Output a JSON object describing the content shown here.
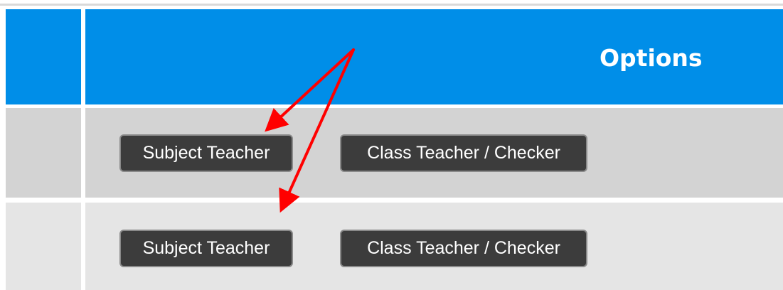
{
  "table": {
    "header": {
      "options_label": "Options"
    },
    "rows": [
      {
        "subject_teacher_label": "Subject Teacher",
        "class_teacher_label": "Class Teacher / Checker"
      },
      {
        "subject_teacher_label": "Subject Teacher",
        "class_teacher_label": "Class Teacher / Checker"
      }
    ]
  },
  "colors": {
    "header_bg": "#008ee8",
    "row1_bg": "#d3d3d3",
    "row2_bg": "#e5e5e5",
    "button_bg": "#3c3c3c",
    "annotation_arrow": "#ff0000"
  },
  "annotations": {
    "arrow_icon": "red-arrow-icon"
  }
}
